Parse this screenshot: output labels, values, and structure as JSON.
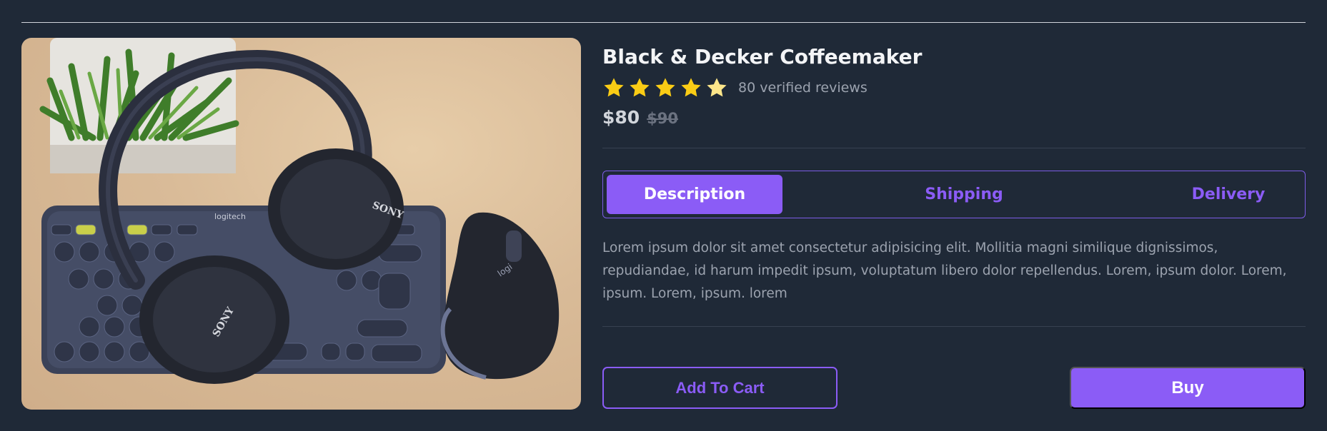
{
  "product": {
    "title": "Black & Decker Coffeemaker",
    "rating": 4.5,
    "rating_max": 5,
    "reviews_text": "80 verified reviews",
    "price": "$80",
    "original_price": "$90",
    "image_alt": "Product photo"
  },
  "tabs": [
    {
      "label": "Description",
      "active": true
    },
    {
      "label": "Shipping",
      "active": false
    },
    {
      "label": "Delivery",
      "active": false
    }
  ],
  "description": "Lorem ipsum dolor sit amet consectetur adipisicing elit. Mollitia magni similique dignissimos, repudiandae, id harum impedit ipsum, voluptatum libero dolor repellendus. Lorem, ipsum dolor. Lorem, ipsum. Lorem, ipsum. lorem",
  "actions": {
    "add_to_cart": "Add To Cart",
    "buy": "Buy"
  },
  "colors": {
    "background": "#1f2937",
    "accent": "#8b5cf6",
    "star_full": "#facc15",
    "star_half": "#fde68a"
  },
  "image_labels": {
    "keyboard_brand": "logitech",
    "headphone_brand_1": "SONY",
    "headphone_brand_2": "SONY",
    "mouse_brand": "logi"
  }
}
